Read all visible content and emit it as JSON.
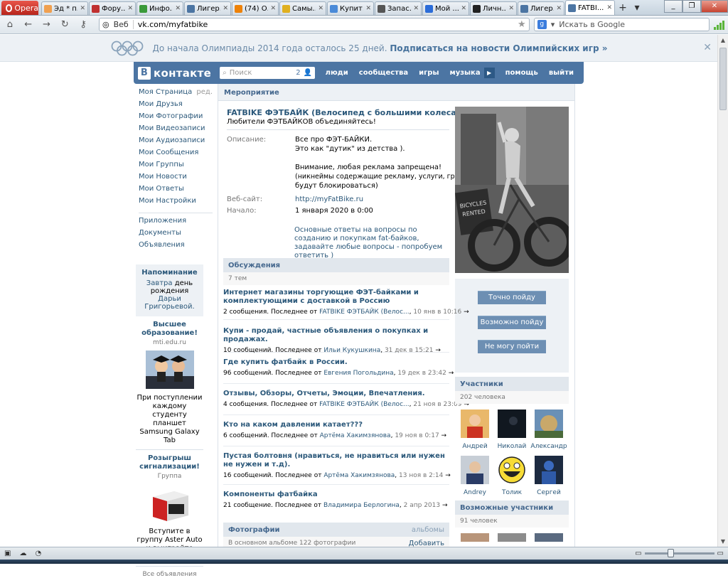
{
  "browser": {
    "opera_label": "Opera",
    "tabs": [
      {
        "label": "Эд * п..."
      },
      {
        "label": "Фору..."
      },
      {
        "label": "Инфо..."
      },
      {
        "label": "Лигер..."
      },
      {
        "label": "(74) О..."
      },
      {
        "label": "Самы..."
      },
      {
        "label": "Купит..."
      },
      {
        "label": "Запас..."
      },
      {
        "label": "Мой ..."
      },
      {
        "label": "Личн..."
      },
      {
        "label": "Лигер..."
      },
      {
        "label": "FATBI..."
      }
    ],
    "url": "vk.com/myfatbike",
    "veb_label": "Веб",
    "search_placeholder": "Искать в Google"
  },
  "olympic": {
    "text": "До начала Олимпиады 2014 года осталось 25 дней.",
    "link": "Подписаться на новости Олимпийских игр »"
  },
  "vk_header": {
    "logo": "контакте",
    "search_placeholder": "Поиск",
    "search_count": "2",
    "nav": [
      "люди",
      "сообщества",
      "игры",
      "музыка",
      "помощь",
      "выйти"
    ]
  },
  "left_menu": {
    "items": [
      "Моя Страница",
      "Мои Друзья",
      "Мои Фотографии",
      "Мои Видеозаписи",
      "Мои Аудиозаписи",
      "Мои Сообщения",
      "Мои Группы",
      "Мои Новости",
      "Мои Ответы",
      "Мои Настройки"
    ],
    "edit": "ред.",
    "items2": [
      "Приложения",
      "Документы",
      "Объявления"
    ],
    "reminder": {
      "title": "Напоминание",
      "line1_link": "Завтра",
      "line1_rest": " день",
      "line2": "рождения ",
      "line2_link": "Дарьи",
      "line3_link": "Григорьевой."
    },
    "ad1": {
      "title": "Высшее образование!",
      "site": "mti.edu.ru",
      "body": "При поступлении каждому студенту планшет Samsung Galaxy Tab"
    },
    "ad2": {
      "title": "Розыгрыш сигнализации!",
      "site": "Группа",
      "body": "Вступите в группу Aster Auto и выиграйте сигнализацию!"
    },
    "all_ads": "Все объявления"
  },
  "main": {
    "section_title": "Мероприятие",
    "event_title": "FATBIKE ФЭТБАЙК (Велосипед с большими колесами)",
    "event_sub": "Любители ФЭТБАЙКОВ объединяйтесь!",
    "desc_label": "Описание:",
    "desc_lines": [
      "Все про ФЭТ-БАЙКИ.",
      "Это как \"дутик\" из детства )."
    ],
    "warn_lines": [
      "Внимание, любая реклама запрещена!",
      "(никнеймы содержащие рекламу, услуги, группы,",
      "будут блокироваться)"
    ],
    "site_label": "Веб-сайт:",
    "site": "http://myFatBike.ru",
    "start_label": "Начало:",
    "start": "1 января 2020 в 0:00",
    "faq": "Основные ответы на вопросы по созданию и покупкам fat-байков, задавайте любые вопросы - попробуем ответить )"
  },
  "actions": [
    "Точно пойду",
    "Возможно пойду",
    "Не могу пойти"
  ],
  "discussions": {
    "title": "Обсуждения",
    "count": "7 тем",
    "topics": [
      {
        "title": "Интернет магазины торгующие ФЭТ-байками и комплектующими с доставкой в Россию",
        "msgs": "2 сообщения. Последнее от ",
        "author": "FATBIKE ФЭТБАЙК (Велос...",
        "date": "10 янв в 10:16"
      },
      {
        "title": "Купи - продай, частные объявления о покупках и продажах.",
        "msgs": "10 сообщений. Последнее от ",
        "author": "Ильи Кукушкина",
        "date": "31 дек в 15:21"
      },
      {
        "title": "Где купить фатбайк в России.",
        "msgs": "96 сообщений. Последнее от ",
        "author": "Евгения Погольдина",
        "date": "19 дек в 23:42"
      },
      {
        "title": "Отзывы, Обзоры, Отчеты, Эмоции, Впечатления.",
        "msgs": "4 сообщения. Последнее от ",
        "author": "FATBIKE ФЭТБАЙК (Велос...",
        "date": "21 ноя в 23:09"
      },
      {
        "title": "Кто на каком давлении катает???",
        "msgs": "6 сообщений. Последнее от ",
        "author": "Артёма Хакимзянова",
        "date": "19 ноя в 0:17"
      },
      {
        "title": "Пустая болтовня (нравиться, не нравиться или нужен не нужен и т.д).",
        "msgs": "16 сообщений. Последнее от ",
        "author": "Артёма Хакимзянова",
        "date": "13 ноя в 2:14"
      },
      {
        "title": "Компоненты фатбайка",
        "msgs": "21 сообщение. Последнее от ",
        "author": "Владимира Берлогина",
        "date": "2 апр 2013"
      }
    ]
  },
  "photos": {
    "title": "Фотографии",
    "extra": "альбомы",
    "sub": "В основном альбоме 122 фотографии",
    "add": "Добавить"
  },
  "members": {
    "title": "Участники",
    "count": "202 человека",
    "people": [
      "Андрей",
      "Николай",
      "Александр",
      "Andrey",
      "Толик",
      "Сергей"
    ]
  },
  "possible": {
    "title": "Возможные участники",
    "count": "91 человек"
  }
}
